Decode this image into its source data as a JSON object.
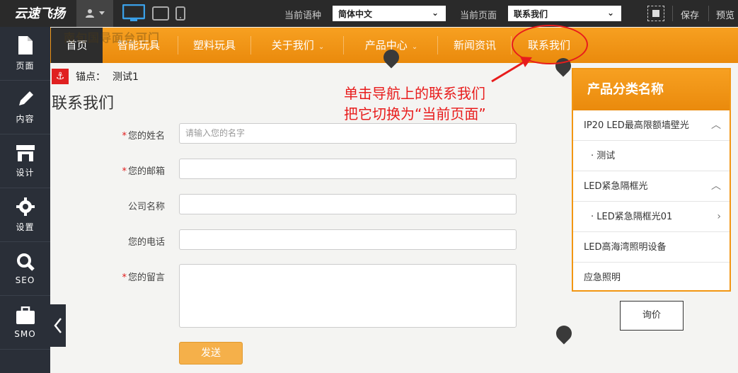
{
  "topbar": {
    "logo_text": "云速飞扬",
    "language_label": "当前语种",
    "language_value": "简体中文",
    "page_label": "当前页面",
    "page_value": "联系我们",
    "save": "保存",
    "preview": "预览"
  },
  "sidebar": {
    "items": [
      {
        "label": "页面",
        "icon": "file-icon"
      },
      {
        "label": "内容",
        "icon": "pencil-icon"
      },
      {
        "label": "设计",
        "icon": "store-icon"
      },
      {
        "label": "设置",
        "icon": "gear-icon"
      },
      {
        "label": "SEO",
        "icon": "search-icon"
      },
      {
        "label": "SMO",
        "icon": "briefcase-icon"
      }
    ]
  },
  "nav": {
    "ghost_text": "南旬国导面台可门",
    "items": [
      {
        "label": "首页",
        "active": true
      },
      {
        "label": "智能玩具"
      },
      {
        "label": "塑料玩具"
      },
      {
        "label": "关于我们",
        "has_caret": true
      },
      {
        "label": "产品中心",
        "has_caret": true
      },
      {
        "label": "新闻资讯"
      },
      {
        "label": "联系我们"
      }
    ]
  },
  "anchor": {
    "label": "锚点：",
    "value": "测试1"
  },
  "page_title": "联系我们",
  "annotation": {
    "line1": "单击导航上的联系我们",
    "line2": "把它切换为“当前页面”",
    "color": "#e81c1c"
  },
  "form": {
    "name_label": "您的姓名",
    "name_placeholder": "请输入您的名字",
    "email_label": "您的邮箱",
    "company_label": "公司名称",
    "phone_label": "您的电话",
    "message_label": "您的留言",
    "send": "发送"
  },
  "category": {
    "title": "产品分类名称",
    "items": [
      {
        "label": "IP20 LED最高限额墙壁光",
        "arrow": "up"
      },
      {
        "label": "· 测试",
        "sub": true
      },
      {
        "label": "LED紧急隔框光",
        "arrow": "up"
      },
      {
        "label": "· LED紧急隔框光01",
        "sub": true,
        "arrow": "right"
      },
      {
        "label": "LED高海湾照明设备"
      },
      {
        "label": "应急照明"
      }
    ]
  },
  "inquiry": "询价",
  "colors": {
    "accent": "#f29612",
    "dark": "#2a2f38"
  }
}
